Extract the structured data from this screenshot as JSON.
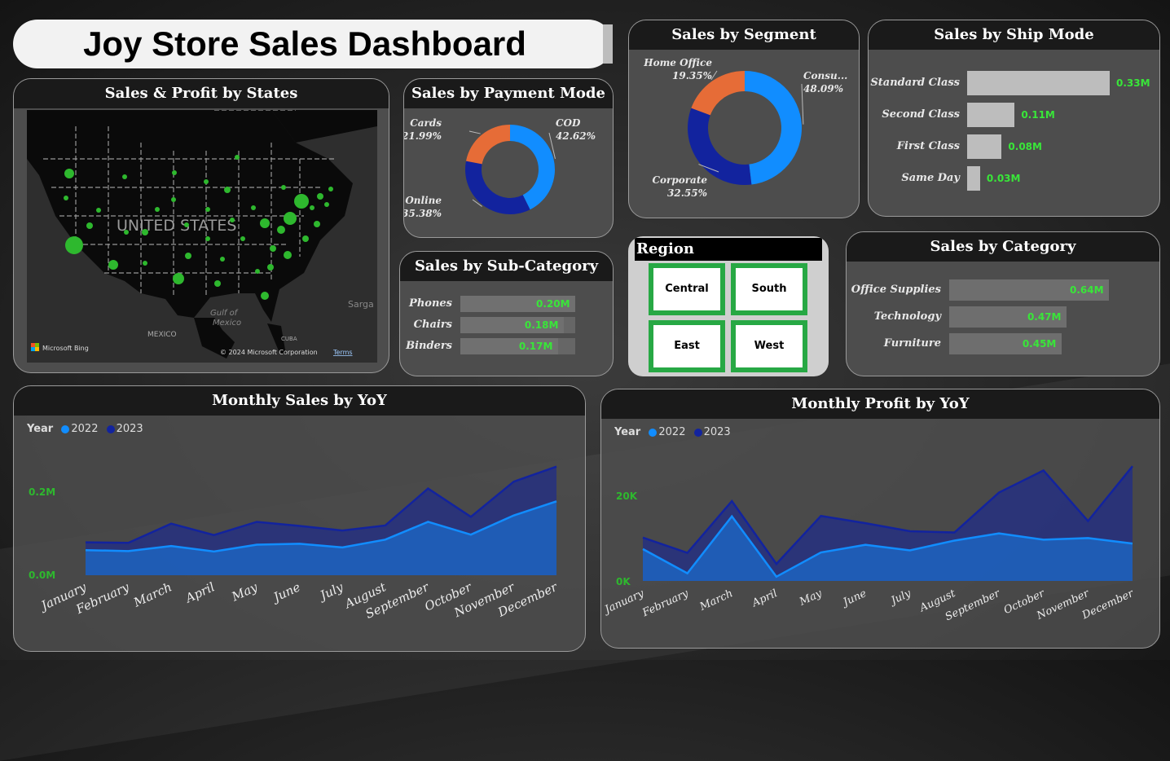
{
  "dashboard": {
    "title": "Joy Store Sales Dashboard"
  },
  "map_card": {
    "title": "Sales & Profit by States",
    "country_label": "UNITED STATES",
    "gulf_label": "Gulf of Mexico",
    "mexico_label": "MEXICO",
    "cuba_label": "CUBA",
    "sargasso_label": "Sarga",
    "bing_label": "Microsoft Bing",
    "copyright": "© 2024 Microsoft Corporation",
    "terms": "Terms"
  },
  "payment_mode": {
    "title": "Sales by Payment Mode",
    "slices": [
      {
        "name": "COD",
        "pct": "42.62%",
        "value": 42.62,
        "color": "#118dff"
      },
      {
        "name": "Online",
        "pct": "35.38%",
        "value": 35.38,
        "color": "#12239e"
      },
      {
        "name": "Cards",
        "pct": "21.99%",
        "value": 21.99,
        "color": "#e66c37"
      }
    ]
  },
  "segment": {
    "title": "Sales by Segment",
    "slices": [
      {
        "name": "Consu...",
        "pct": "48.09%",
        "value": 48.09,
        "color": "#118dff"
      },
      {
        "name": "Corporate",
        "pct": "32.55%",
        "value": 32.55,
        "color": "#12239e"
      },
      {
        "name": "Home Office",
        "pct": "19.35%",
        "value": 19.35,
        "color": "#e66c37"
      }
    ]
  },
  "ship_mode": {
    "title": "Sales by Ship Mode",
    "rows": [
      {
        "label": "Standard Class",
        "value_label": "0.33M",
        "value": 0.33
      },
      {
        "label": "Second Class",
        "value_label": "0.11M",
        "value": 0.11
      },
      {
        "label": "First Class",
        "value_label": "0.08M",
        "value": 0.08
      },
      {
        "label": "Same Day",
        "value_label": "0.03M",
        "value": 0.03
      }
    ]
  },
  "sub_category": {
    "title": "Sales by Sub-Category",
    "rows": [
      {
        "label": "Phones",
        "value_label": "0.20M",
        "value": 0.2
      },
      {
        "label": "Chairs",
        "value_label": "0.18M",
        "value": 0.18
      },
      {
        "label": "Binders",
        "value_label": "0.17M",
        "value": 0.17
      }
    ]
  },
  "region": {
    "title": "Region",
    "buttons": [
      "Central",
      "South",
      "East",
      "West"
    ]
  },
  "category": {
    "title": "Sales by Category",
    "rows": [
      {
        "label": "Office Supplies",
        "value_label": "0.64M",
        "value": 0.64
      },
      {
        "label": "Technology",
        "value_label": "0.47M",
        "value": 0.47
      },
      {
        "label": "Furniture",
        "value_label": "0.45M",
        "value": 0.45
      }
    ]
  },
  "colors": {
    "series_2022": "#118dff",
    "series_2023": "#12239e",
    "accent_green": "#39e639"
  },
  "chart_data": [
    {
      "type": "area",
      "title": "Monthly Sales by YoY",
      "legend_title": "Year",
      "categories": [
        "January",
        "February",
        "March",
        "April",
        "May",
        "June",
        "July",
        "August",
        "September",
        "October",
        "November",
        "December"
      ],
      "series": [
        {
          "name": "2022",
          "values": [
            0.055,
            0.053,
            0.064,
            0.052,
            0.067,
            0.069,
            0.061,
            0.078,
            0.117,
            0.089,
            0.131,
            0.162
          ]
        },
        {
          "name": "2023",
          "values": [
            0.072,
            0.071,
            0.113,
            0.088,
            0.117,
            0.108,
            0.098,
            0.109,
            0.19,
            0.128,
            0.205,
            0.238
          ]
        }
      ],
      "yticks": [
        "0.0M",
        "0.2M"
      ],
      "ylim": [
        0,
        0.25
      ]
    },
    {
      "type": "area",
      "title": "Monthly Profit by YoY",
      "legend_title": "Year",
      "categories": [
        "January",
        "February",
        "March",
        "April",
        "May",
        "June",
        "July",
        "August",
        "September",
        "October",
        "November",
        "December"
      ],
      "series": [
        {
          "name": "2022",
          "values": [
            7500,
            1800,
            15200,
            1000,
            6700,
            8500,
            7200,
            9500,
            11200,
            9700,
            10100,
            8800
          ]
        },
        {
          "name": "2023",
          "values": [
            10200,
            6600,
            18800,
            4000,
            15300,
            13600,
            11700,
            11400,
            20800,
            26000,
            14100,
            27000
          ]
        }
      ],
      "yticks": [
        "0K",
        "20K"
      ],
      "ylim": [
        0,
        28000
      ]
    }
  ]
}
